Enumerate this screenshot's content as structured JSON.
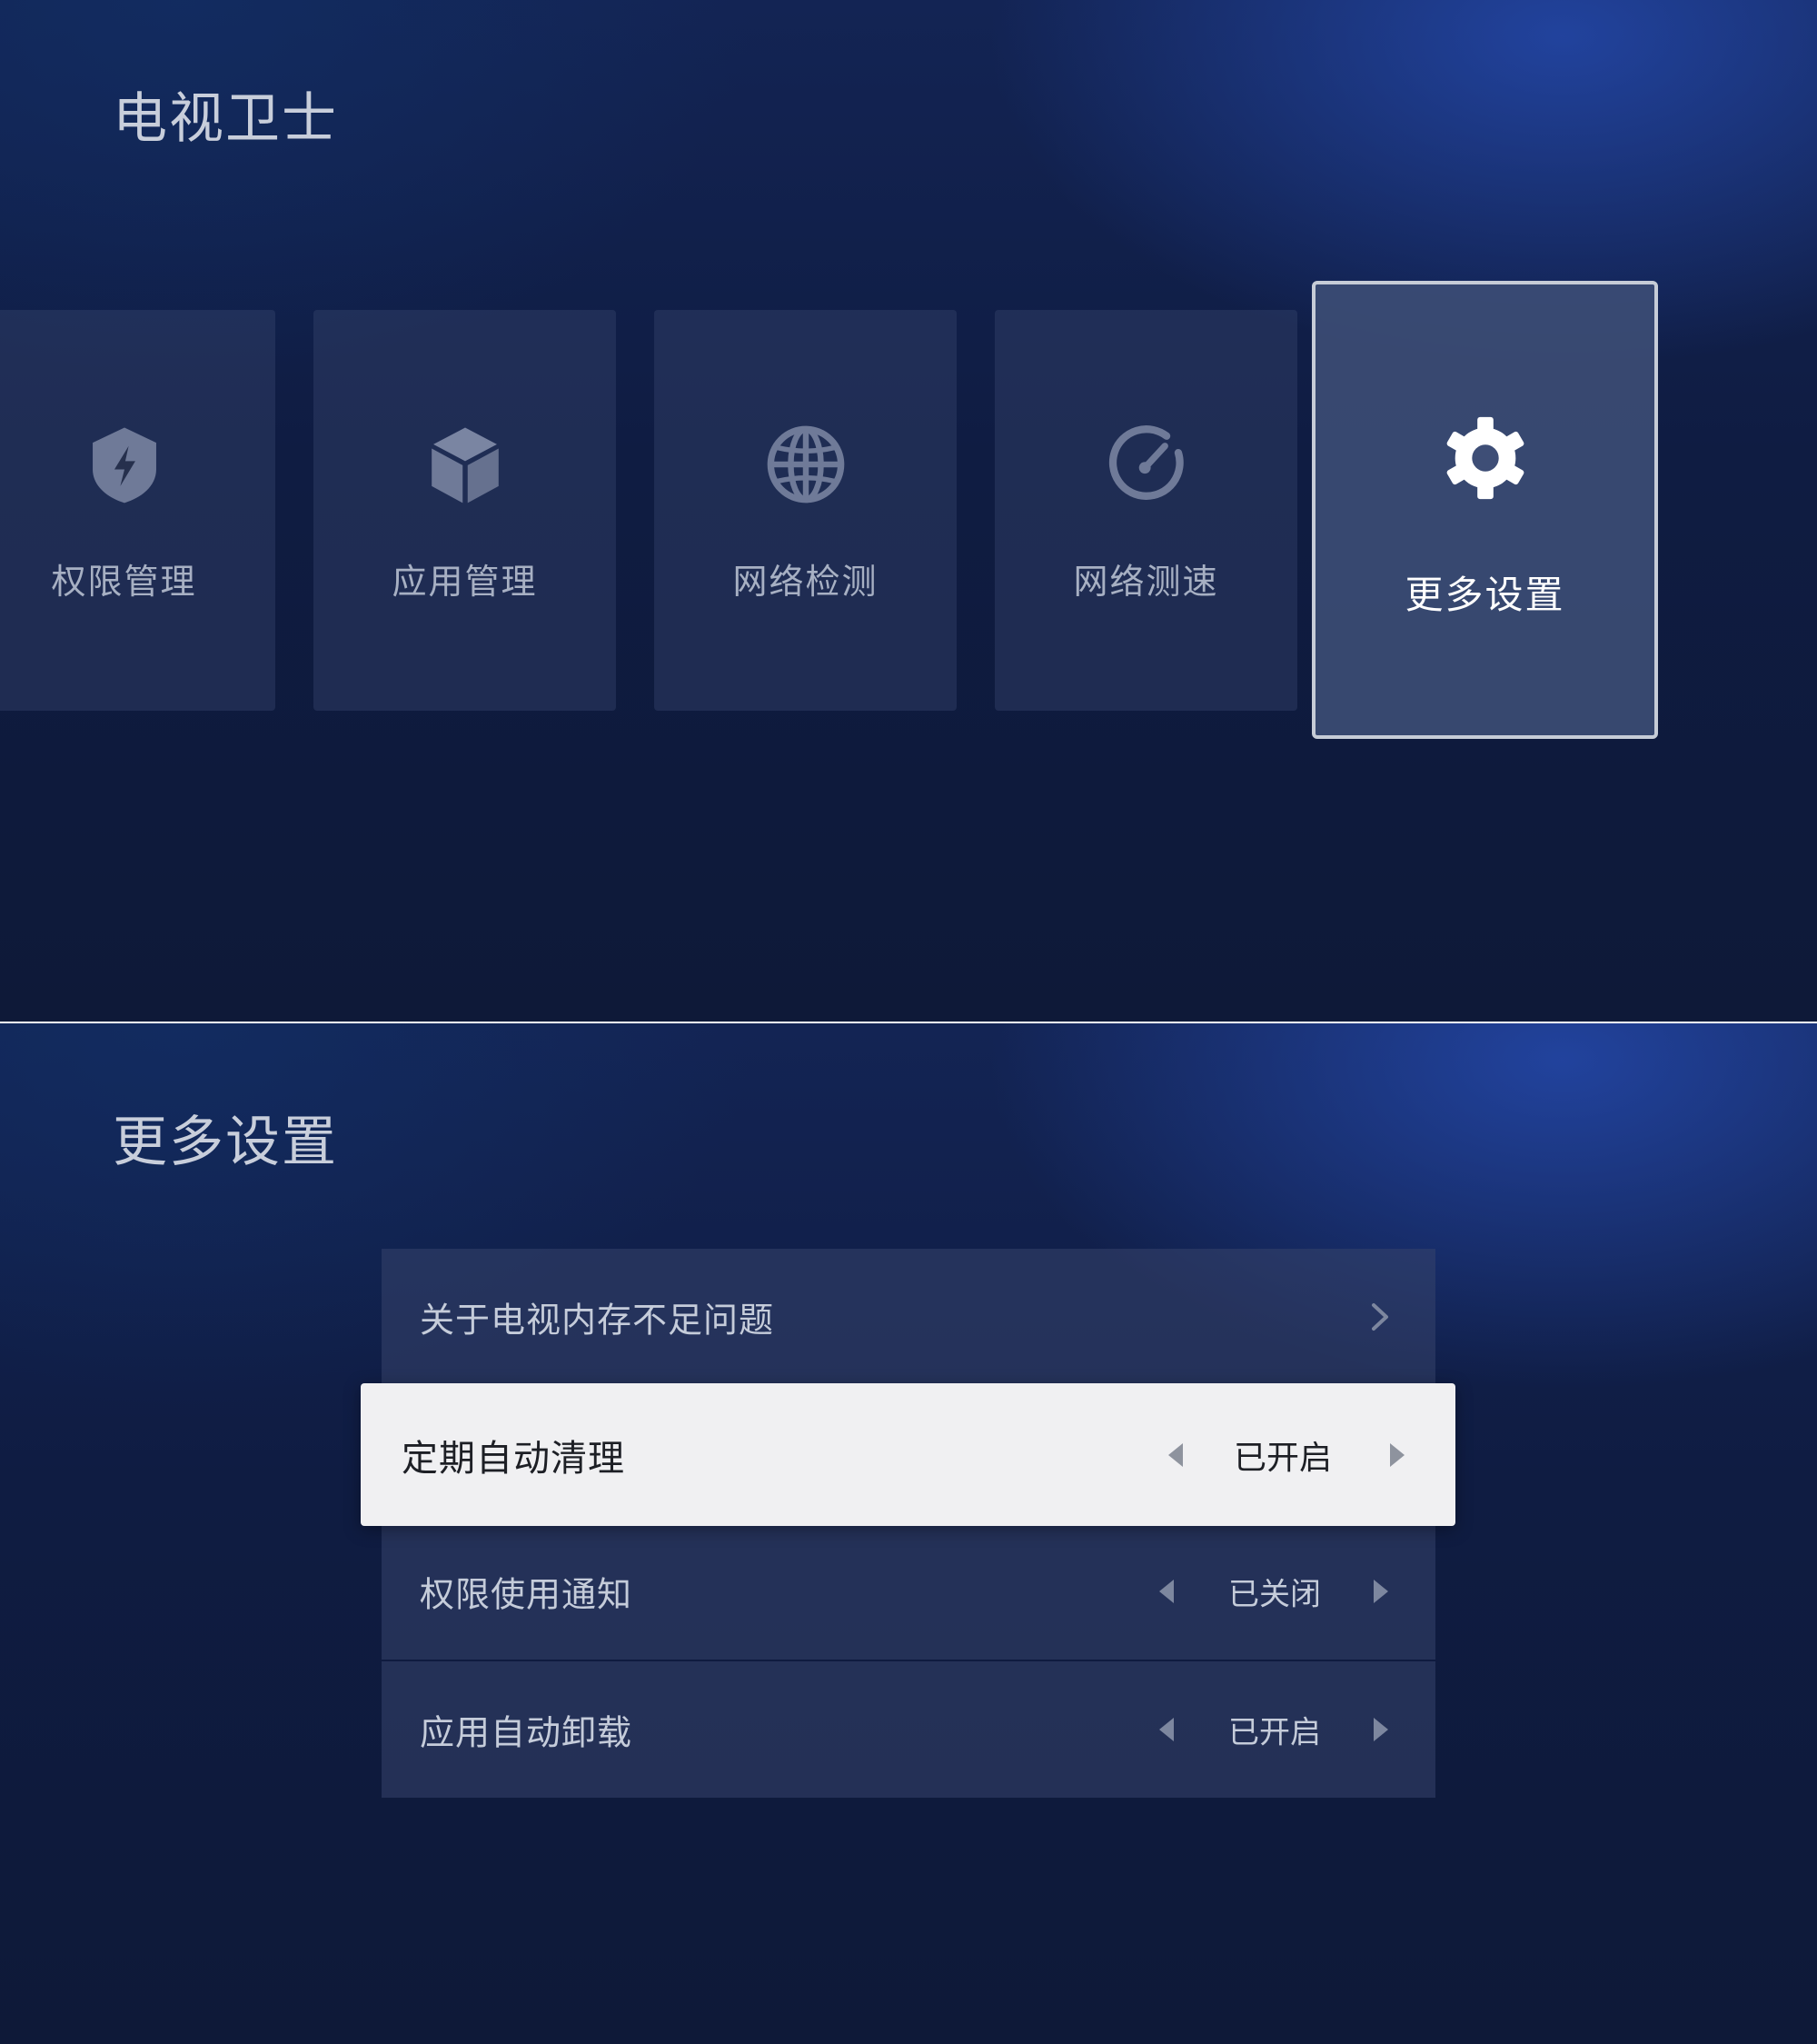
{
  "home": {
    "title": "电视卫士",
    "cards": [
      {
        "label": "权限管理",
        "icon": "shield-lightning-icon"
      },
      {
        "label": "应用管理",
        "icon": "cube-icon"
      },
      {
        "label": "网络检测",
        "icon": "globe-icon"
      },
      {
        "label": "网络测速",
        "icon": "speedometer-icon"
      },
      {
        "label": "更多设置",
        "icon": "gear-icon",
        "focused": true
      }
    ]
  },
  "more_settings": {
    "title": "更多设置",
    "items": [
      {
        "label": "关于电视内存不足问题",
        "type": "link",
        "icon": "chevron-right-icon"
      },
      {
        "label": "定期自动清理",
        "type": "selector",
        "value": "已开启",
        "focused": true
      },
      {
        "label": "权限使用通知",
        "type": "selector",
        "value": "已关闭"
      },
      {
        "label": "应用自动卸载",
        "type": "selector",
        "value": "已开启"
      }
    ]
  },
  "colors": {
    "background": "#0f1c42",
    "card": "#2b3658",
    "focused_border": "#c6ccd7",
    "focused_row": "#f0f0f2",
    "icon_dim": "#6f7a98",
    "text_dim": "#a7b0c3"
  }
}
